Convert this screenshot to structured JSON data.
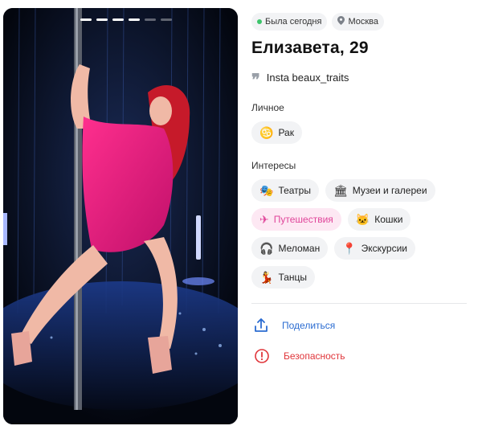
{
  "profile": {
    "status": "Была сегодня",
    "city": "Москва",
    "name_age": "Елизавета, 29",
    "about": "Insta beaux_traits"
  },
  "photo": {
    "count": 6,
    "current": 4
  },
  "personal": {
    "title": "Личное",
    "items": [
      {
        "label": "Рак",
        "icon": "cancer-zodiac-icon",
        "glyph": "♋"
      }
    ]
  },
  "interests": {
    "title": "Интересы",
    "items": [
      {
        "label": "Театры",
        "icon": "theater-masks-icon",
        "glyph": "🎭",
        "active": false
      },
      {
        "label": "Музеи и галереи",
        "icon": "museum-icon",
        "glyph": "🏛",
        "active": false
      },
      {
        "label": "Путешествия",
        "icon": "airplane-icon",
        "glyph": "✈",
        "active": true
      },
      {
        "label": "Кошки",
        "icon": "cat-icon",
        "glyph": "🐱",
        "active": false
      },
      {
        "label": "Меломан",
        "icon": "headphones-icon",
        "glyph": "🎧",
        "active": false
      },
      {
        "label": "Экскурсии",
        "icon": "map-pin-icon",
        "glyph": "📍",
        "active": false
      },
      {
        "label": "Танцы",
        "icon": "dancer-icon",
        "glyph": "💃",
        "active": false
      }
    ]
  },
  "actions": {
    "share": "Поделиться",
    "safety": "Безопасность"
  },
  "colors": {
    "accent_blue": "#2b6cd1",
    "danger_red": "#e0353a",
    "online_green": "#3cc46b",
    "active_chip_bg": "#fde8f3",
    "active_chip_text": "#e0459a"
  }
}
